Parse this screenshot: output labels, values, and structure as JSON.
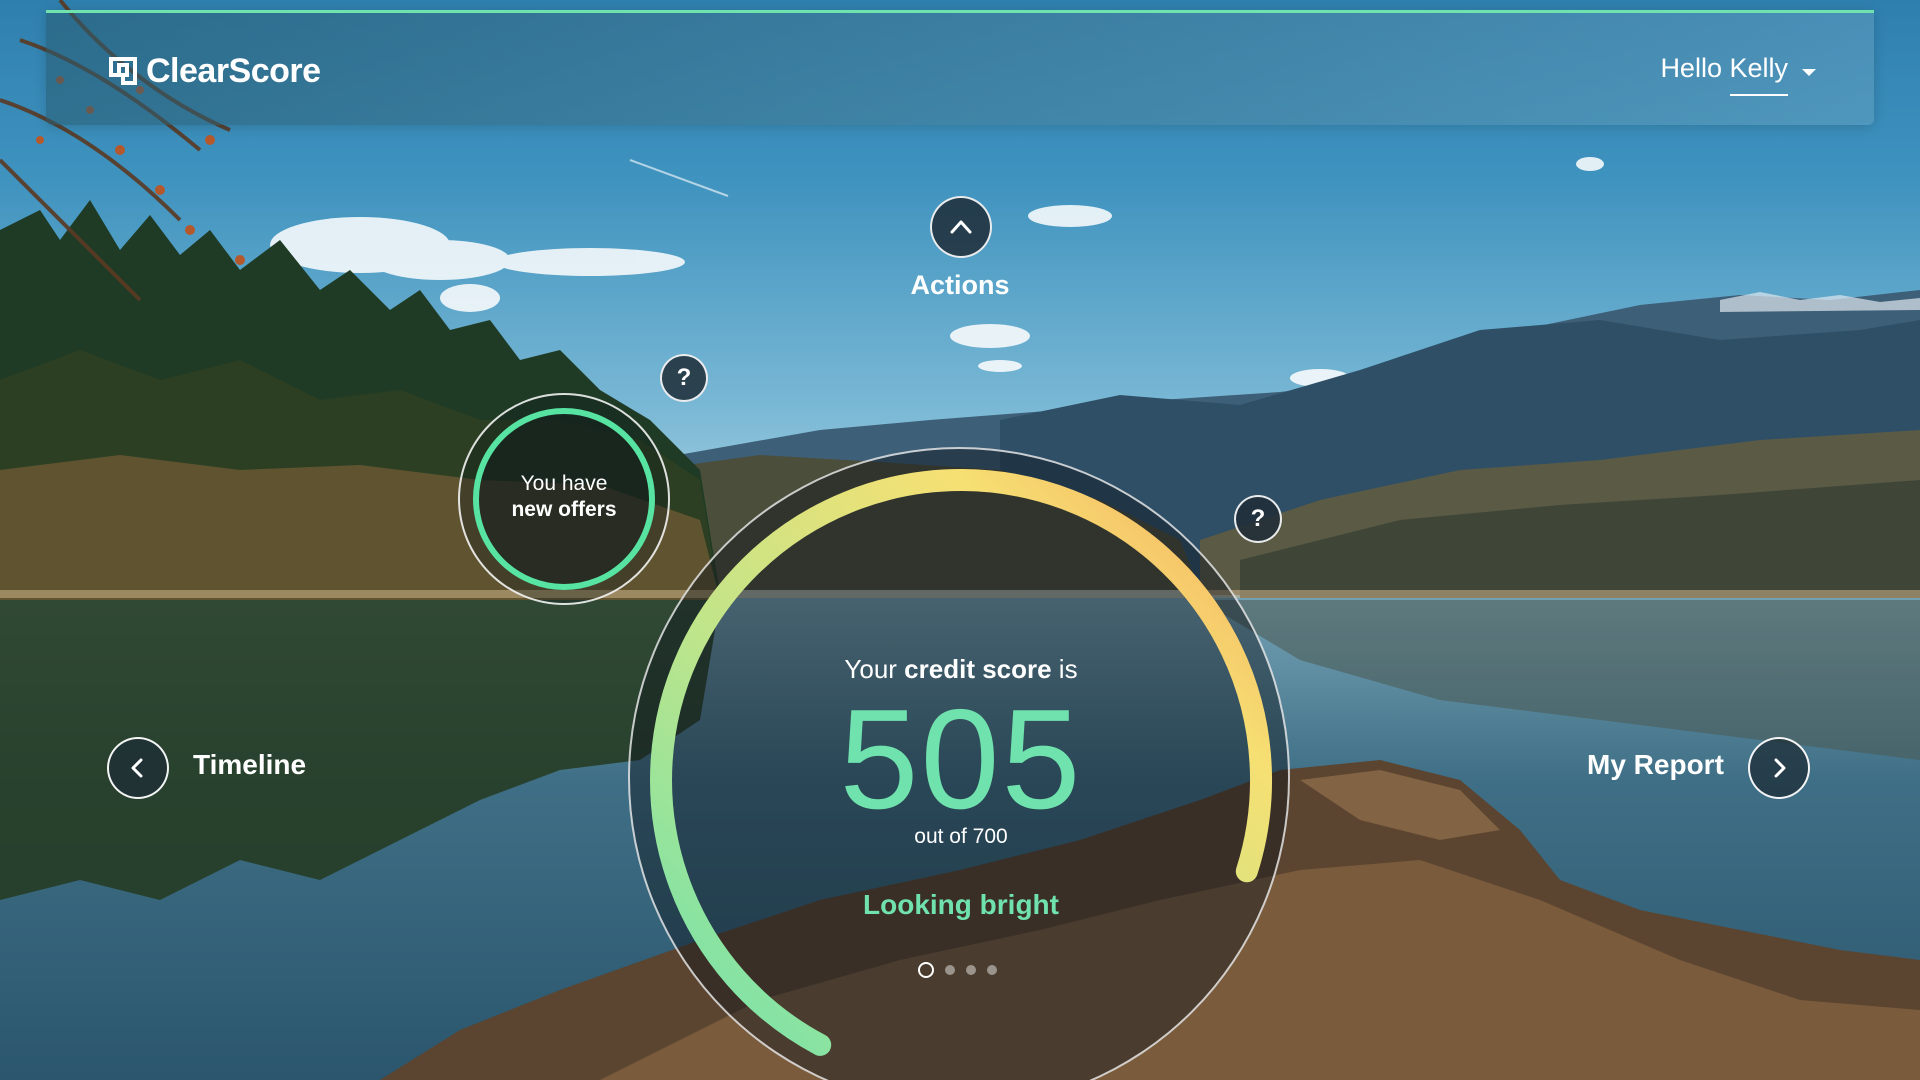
{
  "header": {
    "brand": "ClearScore",
    "greeting": "Hello Kelly",
    "accent_color": "#6fe2ad"
  },
  "actions": {
    "label": "Actions",
    "icon": "chevron-up-icon"
  },
  "help": {
    "symbol": "?"
  },
  "offers": {
    "line1": "You have",
    "line2": "new offers",
    "ring_color": "#57e3a1"
  },
  "timeline": {
    "label": "Timeline",
    "icon": "chevron-left-icon"
  },
  "report": {
    "label": "My Report",
    "icon": "chevron-right-icon"
  },
  "score": {
    "intro_prefix": "Your ",
    "intro_bold": "credit score",
    "intro_suffix": " is",
    "value": "505",
    "out_of": "out of 700",
    "status": "Looking bright",
    "numeric": 505,
    "max": 700,
    "arc_colors": [
      "#6fe2ad",
      "#bfe58a",
      "#f6e073",
      "#f7a95f"
    ]
  },
  "pager": {
    "count": 4,
    "active": 0
  }
}
